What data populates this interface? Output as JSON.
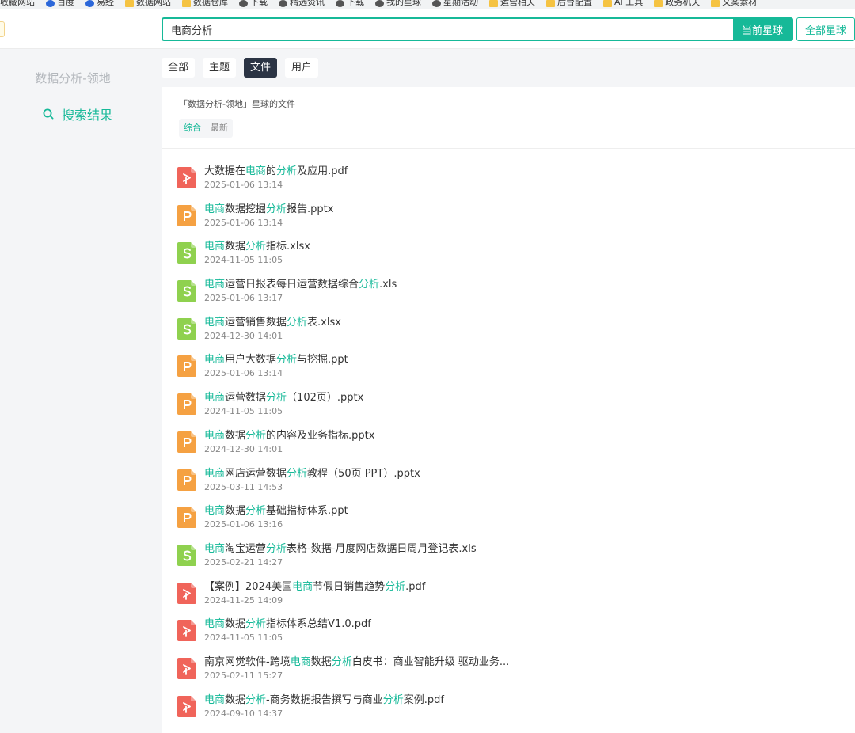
{
  "bookmarks": [
    {
      "label": "收藏网站",
      "icon": "none"
    },
    {
      "label": "百度",
      "icon": "baidu-icon"
    },
    {
      "label": "易经",
      "icon": "blue-globe-icon"
    },
    {
      "label": "数据网站",
      "icon": "folder-icon"
    },
    {
      "label": "数据仓库",
      "icon": "page-icon"
    },
    {
      "label": "下载",
      "icon": "dark-globe-icon"
    },
    {
      "label": "精选资讯",
      "icon": "globe-icon"
    },
    {
      "label": "下载",
      "icon": "globe-icon"
    },
    {
      "label": "我的星球",
      "icon": "globe-icon"
    },
    {
      "label": "星期活动",
      "icon": "globe-icon"
    },
    {
      "label": "运营相关",
      "icon": "folder-icon"
    },
    {
      "label": "后台配置",
      "icon": "folder-icon"
    },
    {
      "label": "AI 工具",
      "icon": "folder-icon"
    },
    {
      "label": "政务机关",
      "icon": "folder-icon"
    },
    {
      "label": "文案素材",
      "icon": "folder-icon"
    }
  ],
  "search": {
    "value": "电商分析",
    "current_label": "当前星球",
    "all_label": "全部星球"
  },
  "sidebar": {
    "group_name": "数据分析-领地",
    "item_label": "搜索结果"
  },
  "tabs": [
    {
      "label": "全部",
      "active": false
    },
    {
      "label": "主题",
      "active": false
    },
    {
      "label": "文件",
      "active": true
    },
    {
      "label": "用户",
      "active": false
    }
  ],
  "panel": {
    "heading": "「数据分析-领地」星球的文件",
    "sort_tabs": [
      {
        "label": "综合",
        "active": true
      },
      {
        "label": "最新",
        "active": false
      }
    ]
  },
  "colors": {
    "accent": "#16b998",
    "pdf": "#f0645a",
    "ppt": "#f5a142",
    "xls": "#8fd14f",
    "tab_active_bg": "#2b3444"
  },
  "files": [
    {
      "type": "pdf",
      "segments": [
        {
          "t": "大数据在"
        },
        {
          "t": "电商",
          "hl": true
        },
        {
          "t": "的"
        },
        {
          "t": "分析",
          "hl": true
        },
        {
          "t": "及应用.pdf"
        }
      ],
      "time": "2025-01-06 13:14"
    },
    {
      "type": "ppt",
      "segments": [
        {
          "t": "电商",
          "hl": true
        },
        {
          "t": "数据挖掘"
        },
        {
          "t": "分析",
          "hl": true
        },
        {
          "t": "报告.pptx"
        }
      ],
      "time": "2025-01-06 13:14"
    },
    {
      "type": "xls",
      "segments": [
        {
          "t": "电商",
          "hl": true
        },
        {
          "t": "数据"
        },
        {
          "t": "分析",
          "hl": true
        },
        {
          "t": "指标.xlsx"
        }
      ],
      "time": "2024-11-05 11:05"
    },
    {
      "type": "xls",
      "segments": [
        {
          "t": "电商",
          "hl": true
        },
        {
          "t": "运营日报表每日运营数据综合"
        },
        {
          "t": "分析",
          "hl": true
        },
        {
          "t": ".xls"
        }
      ],
      "time": "2025-01-06 13:17"
    },
    {
      "type": "xls",
      "segments": [
        {
          "t": "电商",
          "hl": true
        },
        {
          "t": "运营销售数据"
        },
        {
          "t": "分析",
          "hl": true
        },
        {
          "t": "表.xlsx"
        }
      ],
      "time": "2024-12-30 14:01"
    },
    {
      "type": "ppt",
      "segments": [
        {
          "t": "电商",
          "hl": true
        },
        {
          "t": "用户大数据"
        },
        {
          "t": "分析",
          "hl": true
        },
        {
          "t": "与挖掘.ppt"
        }
      ],
      "time": "2025-01-06 13:14"
    },
    {
      "type": "ppt",
      "segments": [
        {
          "t": "电商",
          "hl": true
        },
        {
          "t": "运营数据"
        },
        {
          "t": "分析",
          "hl": true
        },
        {
          "t": "（102页）.pptx"
        }
      ],
      "time": "2024-11-05 11:05"
    },
    {
      "type": "ppt",
      "segments": [
        {
          "t": "电商",
          "hl": true
        },
        {
          "t": "数据"
        },
        {
          "t": "分析",
          "hl": true
        },
        {
          "t": "的内容及业务指标.pptx"
        }
      ],
      "time": "2024-12-30 14:01"
    },
    {
      "type": "ppt",
      "segments": [
        {
          "t": "电商",
          "hl": true
        },
        {
          "t": "网店运营数据"
        },
        {
          "t": "分析",
          "hl": true
        },
        {
          "t": "教程（50页 PPT）.pptx"
        }
      ],
      "time": "2025-03-11 14:53"
    },
    {
      "type": "ppt",
      "segments": [
        {
          "t": "电商",
          "hl": true
        },
        {
          "t": "数据"
        },
        {
          "t": "分析",
          "hl": true
        },
        {
          "t": "基础指标体系.ppt"
        }
      ],
      "time": "2025-01-06 13:16"
    },
    {
      "type": "xls",
      "segments": [
        {
          "t": "电商",
          "hl": true
        },
        {
          "t": "淘宝运营"
        },
        {
          "t": "分析",
          "hl": true
        },
        {
          "t": "表格-数据-月度网店数据日周月登记表.xls"
        }
      ],
      "time": "2025-02-21 14:27"
    },
    {
      "type": "pdf",
      "segments": [
        {
          "t": "【案例】2024美国"
        },
        {
          "t": "电商",
          "hl": true
        },
        {
          "t": "节假日销售趋势"
        },
        {
          "t": "分析",
          "hl": true
        },
        {
          "t": ".pdf"
        }
      ],
      "time": "2024-11-25 14:09"
    },
    {
      "type": "pdf",
      "segments": [
        {
          "t": "电商",
          "hl": true
        },
        {
          "t": "数据"
        },
        {
          "t": "分析",
          "hl": true
        },
        {
          "t": "指标体系总结V1.0.pdf"
        }
      ],
      "time": "2024-11-05 11:05"
    },
    {
      "type": "pdf",
      "segments": [
        {
          "t": "南京网觉软件-跨境"
        },
        {
          "t": "电商",
          "hl": true
        },
        {
          "t": "数据"
        },
        {
          "t": "分析",
          "hl": true
        },
        {
          "t": "白皮书：商业智能升级 驱动业务..."
        }
      ],
      "time": "2025-02-11 15:27"
    },
    {
      "type": "pdf",
      "segments": [
        {
          "t": "电商",
          "hl": true
        },
        {
          "t": "数据"
        },
        {
          "t": "分析",
          "hl": true
        },
        {
          "t": "-商务数据报告撰写与商业"
        },
        {
          "t": "分析",
          "hl": true
        },
        {
          "t": "案例.pdf"
        }
      ],
      "time": "2024-09-10 14:37"
    }
  ]
}
